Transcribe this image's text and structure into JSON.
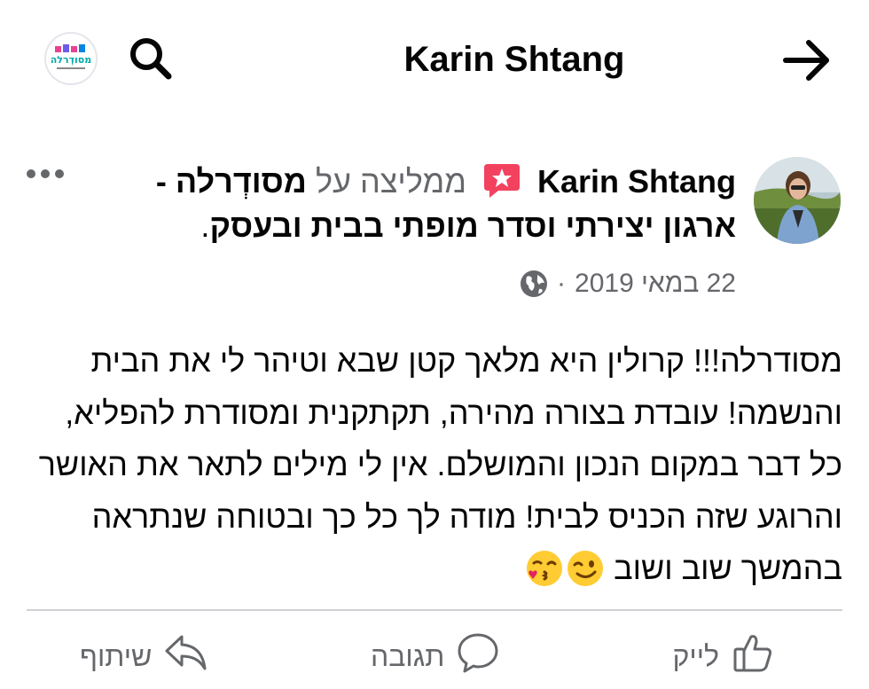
{
  "topbar": {
    "logo_text": "מסודְרלה",
    "logo_icon": "page-logo",
    "search_icon": "search-icon",
    "title": "Karin Shtang",
    "back_icon": "arrow-right-icon"
  },
  "post": {
    "author": "Karin Shtang",
    "recommends_text": "ממליצה על",
    "page_name": "מסודְרלה - ארגון יצירתי וסדר מופתי בבית ובעסק",
    "date": "22 במאי 2019",
    "separator": "·",
    "privacy_icon": "globe-icon",
    "body": "מסודרלה!!! קרולין היא מלאך קטן שבא וטיהר לי את הבית והנשמה! עובדת בצורה מהירה, תקתקנית ומסודרת להפליא, כל דבר במקום הנכון והמושלם. אין לי מילים לתאר את האושר והרוגע שזה הכניס לבית! מודה לך כל כך ובטוחה שנתראה בהמשך שוב ושוב",
    "emojis": [
      "winking-face",
      "face-blowing-kiss"
    ]
  },
  "actions": {
    "like": "לייק",
    "comment": "תגובה",
    "share": "שיתוף"
  },
  "colors": {
    "text": "#050505",
    "secondary": "#65676b",
    "recommend_badge": "#f3425f",
    "divider": "#ced0d4"
  }
}
